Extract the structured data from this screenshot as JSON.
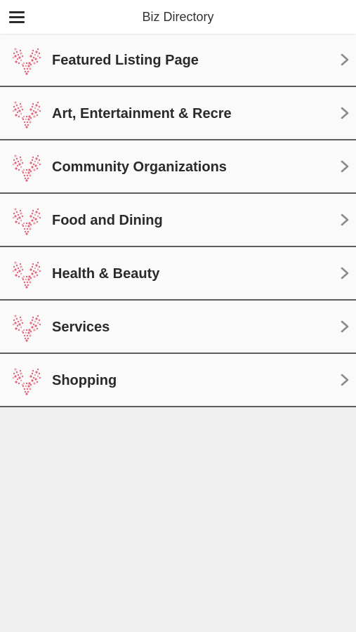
{
  "header": {
    "title": "Biz Directory"
  },
  "colors": {
    "accent": "#e0566f",
    "divider": "#5d5d5d"
  },
  "list": {
    "items": [
      {
        "label": "Featured Listing Page",
        "icon": "deer-antler-logo-icon"
      },
      {
        "label": "Art, Entertainment & Recre",
        "icon": "deer-antler-logo-icon"
      },
      {
        "label": "Community Organizations",
        "icon": "deer-antler-logo-icon"
      },
      {
        "label": "Food and Dining",
        "icon": "deer-antler-logo-icon"
      },
      {
        "label": "Health & Beauty",
        "icon": "deer-antler-logo-icon"
      },
      {
        "label": "Services",
        "icon": "deer-antler-logo-icon"
      },
      {
        "label": "Shopping",
        "icon": "deer-antler-logo-icon"
      }
    ]
  }
}
